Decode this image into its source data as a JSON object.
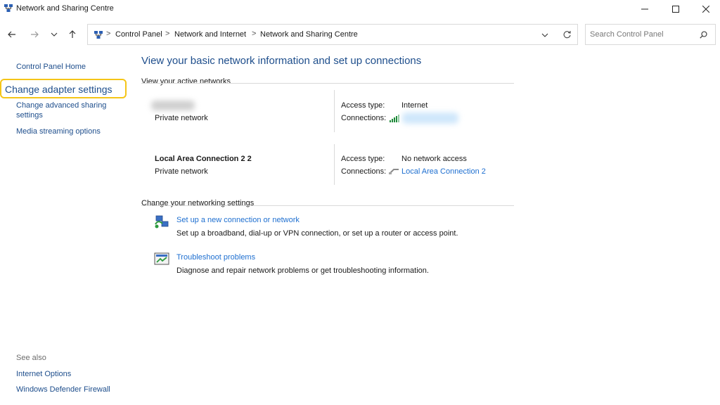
{
  "window": {
    "title": "Network and Sharing Centre",
    "controls": {
      "minimize": "minimize-icon",
      "maximize": "maximize-icon",
      "close": "close-icon"
    }
  },
  "nav": {
    "back": "back-arrow-icon",
    "forward": "forward-arrow-icon",
    "recent": "chevron-down-icon",
    "up": "up-arrow-icon"
  },
  "breadcrumb": {
    "items": [
      "Control Panel",
      "Network and Internet",
      "Network and Sharing Centre"
    ],
    "separator": ">"
  },
  "search": {
    "placeholder": "Search Control Panel"
  },
  "sidebar": {
    "home": "Control Panel Home",
    "adapter": "Change adapter settings",
    "advanced_line1": "Change advanced sharing",
    "advanced_line2": "settings",
    "media": "Media streaming options",
    "see_also": "See also",
    "internet_options": "Internet Options",
    "firewall": "Windows Defender Firewall"
  },
  "main": {
    "title": "View your basic network information and set up connections",
    "active_header": "View your active networks",
    "networks": [
      {
        "name": "",
        "type": "Private network",
        "access_label": "Access type:",
        "access_value": "Internet",
        "connections_label": "Connections:",
        "connection_value": ""
      },
      {
        "name": "Local Area Connection 2 2",
        "type": "Private network",
        "access_label": "Access type:",
        "access_value": "No network access",
        "connections_label": "Connections:",
        "connection_value": "Local Area Connection 2"
      }
    ],
    "settings_header": "Change your networking settings",
    "tasks": [
      {
        "link": "Set up a new connection or network",
        "desc": "Set up a broadband, dial-up or VPN connection, or set up a router or access point."
      },
      {
        "link": "Troubleshoot problems",
        "desc": "Diagnose and repair network problems or get troubleshooting information."
      }
    ]
  },
  "colors": {
    "link": "#1e6fd0",
    "sidebar_link": "#1e4e8c",
    "highlight": "#f5c518"
  }
}
